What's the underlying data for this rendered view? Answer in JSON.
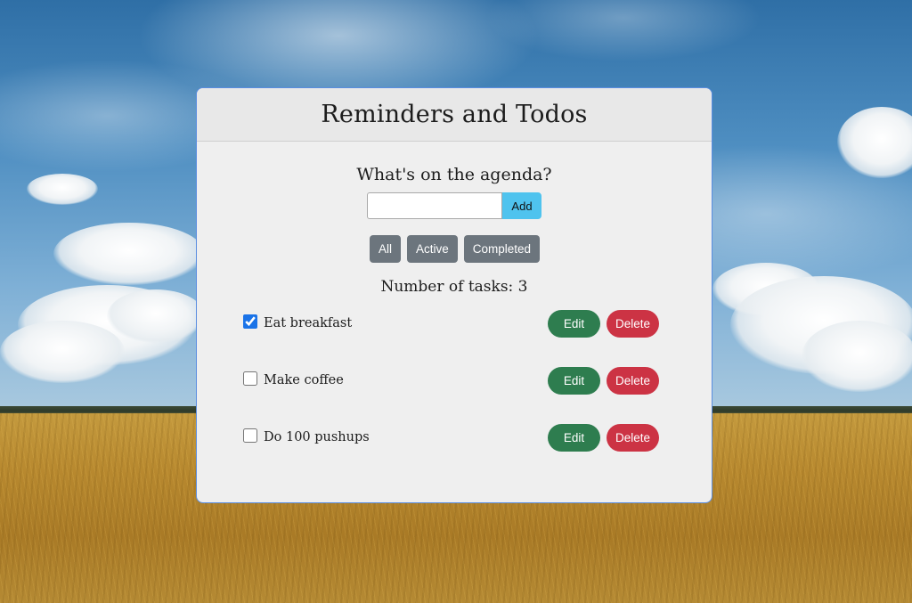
{
  "app": {
    "title": "Reminders and Todos"
  },
  "form": {
    "prompt": "What's on the agenda?",
    "input_value": "",
    "input_placeholder": "",
    "add_label": "Add"
  },
  "filters": [
    {
      "label": "All"
    },
    {
      "label": "Active"
    },
    {
      "label": "Completed"
    }
  ],
  "task_count_text": "Number of tasks: 3",
  "tasks": [
    {
      "label": "Eat breakfast",
      "completed": true,
      "edit_label": "Edit",
      "delete_label": "Delete"
    },
    {
      "label": "Make coffee",
      "completed": false,
      "edit_label": "Edit",
      "delete_label": "Delete"
    },
    {
      "label": "Do 100 pushups",
      "completed": false,
      "edit_label": "Edit",
      "delete_label": "Delete"
    }
  ],
  "colors": {
    "card_background": "#efefef",
    "card_border": "#5a8de0",
    "add_button": "#4fc3ee",
    "filter_button": "#6c757d",
    "edit_button": "#2e7d4f",
    "delete_button": "#cc3344"
  }
}
